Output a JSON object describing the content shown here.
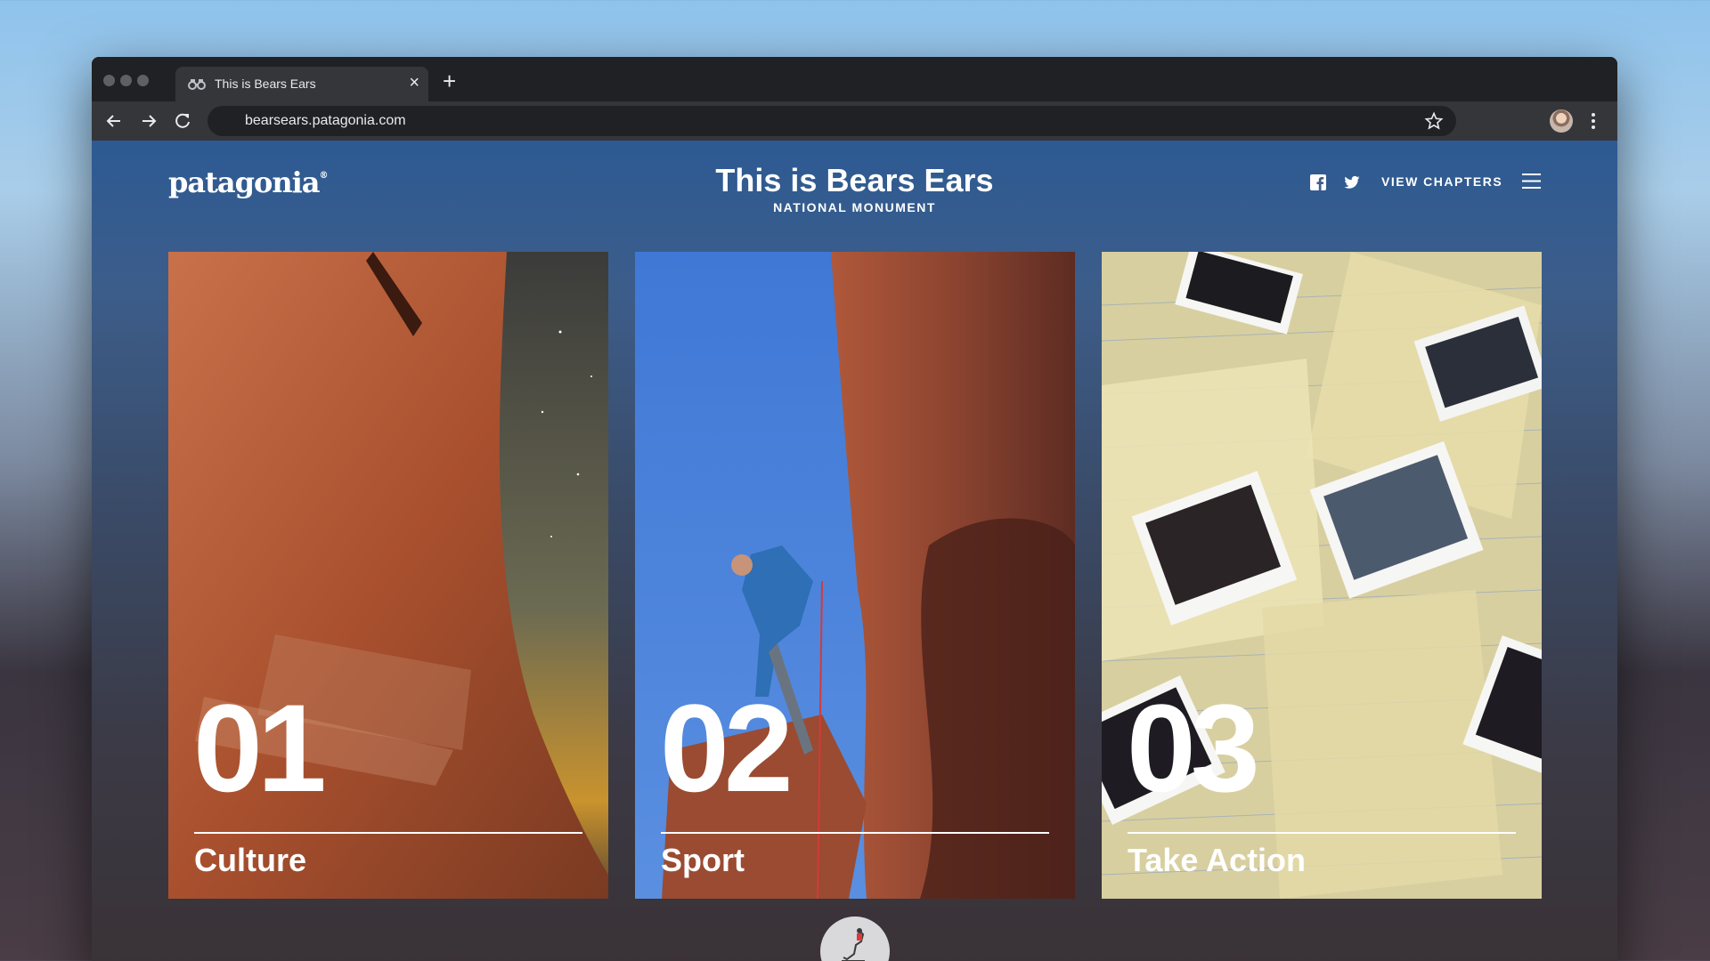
{
  "browser": {
    "tab": {
      "title": "This is Bears Ears",
      "favicon": "binoculars-icon"
    },
    "address_bar": {
      "url": "bearsears.patagonia.com"
    },
    "icons": [
      "back-arrow-icon",
      "forward-arrow-icon",
      "reload-icon",
      "star-icon",
      "profile-avatar",
      "more-menu-icon",
      "close-icon",
      "plus-icon"
    ]
  },
  "site": {
    "logo": "patagonia",
    "title": "This is Bears Ears",
    "subtitle": "NATIONAL MONUMENT",
    "nav": {
      "view_chapters": "VIEW CHAPTERS"
    },
    "social": [
      "facebook-icon",
      "twitter-icon"
    ]
  },
  "chapters": [
    {
      "number": "01",
      "label": "Culture"
    },
    {
      "number": "02",
      "label": "Sport"
    },
    {
      "number": "03",
      "label": "Take Action"
    }
  ],
  "colors": {
    "tabstrip": "#202124",
    "toolbar": "#35363a",
    "page_top": "#2d5a93",
    "page_bottom": "#3a3236",
    "text": "#ffffff"
  }
}
